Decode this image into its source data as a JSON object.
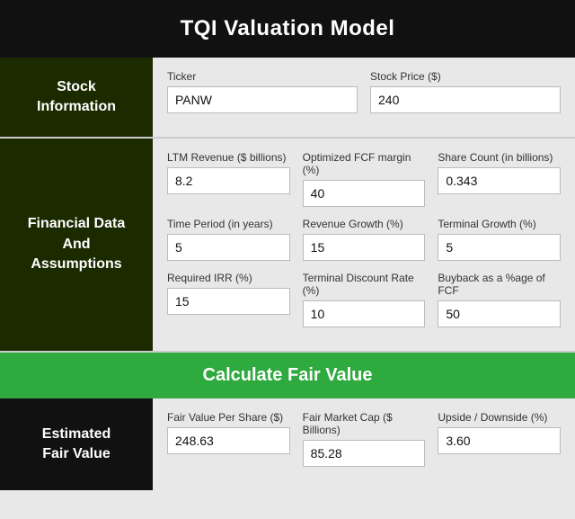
{
  "header": {
    "title": "TQI Valuation Model"
  },
  "stock_section": {
    "label": "Stock\nInformation",
    "fields": [
      {
        "label": "Ticker",
        "value": "PANW",
        "name": "ticker-input"
      },
      {
        "label": "Stock Price ($)",
        "value": "240",
        "name": "stock-price-input"
      }
    ]
  },
  "financial_section": {
    "label": "Financial Data\nAnd\nAssumptions",
    "rows": [
      [
        {
          "label": "LTM Revenue ($ billions)",
          "value": "8.2",
          "name": "ltm-revenue-input"
        },
        {
          "label": "Optimized FCF margin (%)",
          "value": "40",
          "name": "fcf-margin-input"
        },
        {
          "label": "Share Count (in billions)",
          "value": "0.343",
          "name": "share-count-input"
        }
      ],
      [
        {
          "label": "Time Period (in years)",
          "value": "5",
          "name": "time-period-input"
        },
        {
          "label": "Revenue Growth (%)",
          "value": "15",
          "name": "revenue-growth-input"
        },
        {
          "label": "Terminal Growth (%)",
          "value": "5",
          "name": "terminal-growth-input"
        }
      ],
      [
        {
          "label": "Required IRR (%)",
          "value": "15",
          "name": "required-irr-input"
        },
        {
          "label": "Terminal Discount Rate (%)",
          "value": "10",
          "name": "terminal-discount-input"
        },
        {
          "label": "Buyback as a %age of FCF",
          "value": "50",
          "name": "buyback-input"
        }
      ]
    ]
  },
  "calculate_button": {
    "label": "Calculate Fair Value"
  },
  "estimated_section": {
    "label": "Estimated\nFair Value",
    "fields": [
      {
        "label": "Fair Value Per Share ($)",
        "value": "248.63",
        "name": "fair-value-per-share-input"
      },
      {
        "label": "Fair Market Cap ($ Billions)",
        "value": "85.28",
        "name": "fair-market-cap-input"
      },
      {
        "label": "Upside / Downside (%)",
        "value": "3.60",
        "name": "upside-downside-input"
      }
    ]
  }
}
